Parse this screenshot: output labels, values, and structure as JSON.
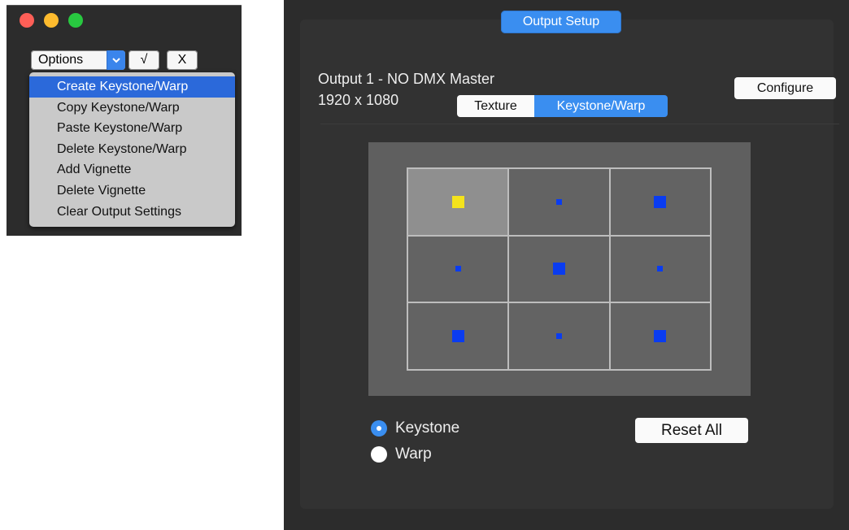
{
  "mini_window": {
    "options_select": {
      "value": "Options"
    },
    "check_button": {
      "label": "√"
    },
    "x_button": {
      "label": "X"
    },
    "menu": {
      "items": [
        {
          "label": "Create Keystone/Warp",
          "selected": true
        },
        {
          "label": "Copy Keystone/Warp"
        },
        {
          "label": "Paste Keystone/Warp"
        },
        {
          "label": "Delete Keystone/Warp"
        },
        {
          "label": "Add Vignette"
        },
        {
          "label": "Delete Vignette"
        },
        {
          "label": "Clear Output Settings"
        }
      ]
    }
  },
  "panel": {
    "header_tab": "Output Setup",
    "output_title": "Output 1 - NO DMX Master",
    "resolution": "1920 x 1080",
    "configure_label": "Configure",
    "segments": {
      "texture": "Texture",
      "keystone": "Keystone/Warp"
    },
    "grid": {
      "selected_cell": 0,
      "handles": [
        "yellow-big",
        "blue-small",
        "blue-big",
        "blue-small",
        "blue-big",
        "blue-small",
        "blue-big",
        "blue-small",
        "blue-big"
      ]
    },
    "radios": [
      {
        "label": "Keystone",
        "checked": true
      },
      {
        "label": "Warp",
        "checked": false
      }
    ],
    "reset_label": "Reset All"
  },
  "colors": {
    "accent": "#3a8ef0",
    "handle_blue": "#0a3cf0",
    "handle_yellow": "#f4e31c"
  }
}
